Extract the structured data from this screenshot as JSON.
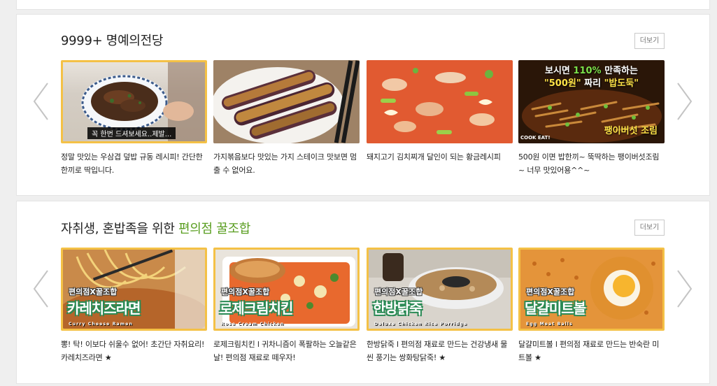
{
  "sections": [
    {
      "title": "9999+ 명예의전당",
      "more_label": "더보기",
      "cards": [
        {
          "caption": "정말 맛있는 우삼겹 덮밥 규동 레시피! 간단한 한끼로 딱입니다.",
          "overlay_subtitle": "꼭 한번 드셔보세요..제발..."
        },
        {
          "caption": "가지볶음보다 맛있는 가지 스테이크 맛보면 멈출 수 없어요."
        },
        {
          "caption": "돼지고기 김치찌개 달인이 되는 황금레시피"
        },
        {
          "caption": "500원 이면 밥한끼~ 뚝딱하는 팽이버섯조림~ 너무 맛있어용^^~",
          "overlay_line1_a": "보시면 ",
          "overlay_line1_b": "110%",
          "overlay_line1_c": " 만족하는",
          "overlay_line2_a": "\"500원\"",
          "overlay_line2_b": " 짜리 ",
          "overlay_line2_c": "\"밥도둑\"",
          "overlay_bottom": "팽이버섯 조림",
          "overlay_logo": "COOK EAT!"
        }
      ]
    },
    {
      "title_main": "자취생, 혼밥족을 위한 ",
      "title_accent": "편의점 꿀조합",
      "more_label": "더보기",
      "cards": [
        {
          "caption": "뽕! 탁! 이보다 쉬울수 없어! 초간단 자취요리! 카레치즈라면 ★",
          "tag": "편의점X꿀조합",
          "name": "카레치즈라면",
          "eng": "Curry Cheese Ramen"
        },
        {
          "caption": "로제크림치킨 l 귀차니즘이 폭팔하는 오늘같은 날! 편의점 재료로 떼우자!",
          "tag": "편의점X꿀조합",
          "name": "로제크림치킨",
          "eng": "Rose Cream Chicken"
        },
        {
          "caption": "한방닭죽 l 편의점 재료로 만드는 건강냉새 물씬 풍기는 쌍화탕닭죽! ★",
          "tag": "편의점X꿀조합",
          "name": "한방닭죽",
          "eng": "Deluxe Chicken Rice Porridge"
        },
        {
          "caption": "달걀미트볼 l 편의점 재료로 만드는 반숙란 미트볼 ★",
          "tag": "편의점X꿀조합",
          "name": "달걀미트볼",
          "eng": "Egg Meat Balls"
        }
      ]
    }
  ],
  "colors": {
    "accent_green": "#5a9e21",
    "border_yellow": "#f4c146",
    "border_teal": "#53c0b0"
  },
  "icons": {
    "prev": "chevron-left-icon",
    "next": "chevron-right-icon"
  }
}
